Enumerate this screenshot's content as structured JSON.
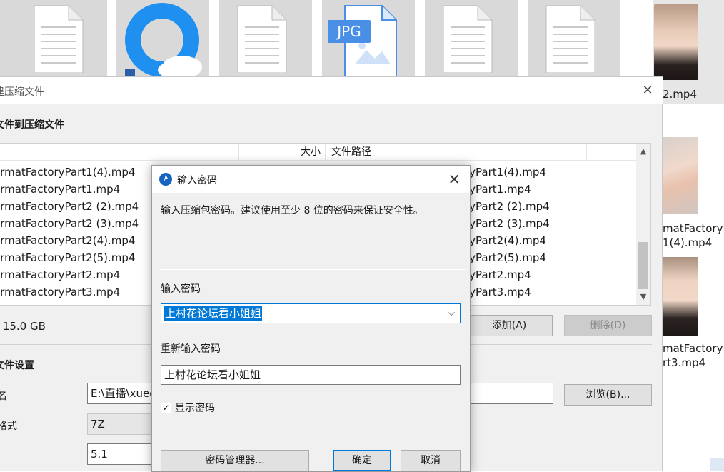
{
  "explorer": {
    "jpg_badge": "JPG",
    "side_videos": [
      {
        "label_line1": "2.mp4",
        "label_line2": ""
      },
      {
        "label_line1": "matFactoryP",
        "label_line2": "1(4).mp4"
      },
      {
        "label_line1": "matFactoryP",
        "label_line2": "rt3.mp4"
      }
    ]
  },
  "archive": {
    "title": "建压缩文件",
    "files_heading": "文件到压缩文件",
    "columns": {
      "size": "大小",
      "path": "文件路径"
    },
    "files": [
      {
        "name": "ormatFactoryPart1(4).mp4",
        "path": "ryPart1(4).mp4"
      },
      {
        "name": "ormatFactoryPart1.mp4",
        "path": "ryPart1.mp4"
      },
      {
        "name": "ormatFactoryPart2 (2).mp4",
        "path": "ryPart2 (2).mp4"
      },
      {
        "name": "ormatFactoryPart2 (3).mp4",
        "path": "ryPart2 (3).mp4"
      },
      {
        "name": "ormatFactoryPart2(4).mp4",
        "path": "ryPart2(4).mp4"
      },
      {
        "name": "ormatFactoryPart2(5).mp4",
        "path": "ryPart2(5).mp4"
      },
      {
        "name": "ormatFactoryPart2.mp4",
        "path": "ryPart2.mp4"
      },
      {
        "name": "ormatFactoryPart3.mp4",
        "path": "ryPart3.mp4"
      }
    ],
    "total_size": ": 15.0 GB",
    "add_label": "添加(A)",
    "delete_label": "删除(D)",
    "settings_heading": "文件设置",
    "path_row_label": "名",
    "path_value": "E:\\直播\\xuee",
    "browse_label": "浏览(B)...",
    "format_row_label": "格式",
    "format_value": "7Z",
    "version_value": "5.1"
  },
  "password_dialog": {
    "title": "输入密码",
    "hint": "输入压缩包密码。建议使用至少 8 位的密码来保证安全性。",
    "password_label": "输入密码",
    "password_value": "上村花论坛看小姐姐",
    "confirm_label": "重新输入密码",
    "confirm_value": "上村花论坛看小姐姐",
    "show_password_label": "显示密码",
    "show_password_checked": true,
    "manager_button": "密码管理器...",
    "ok_button": "确定",
    "cancel_button": "取消"
  },
  "colors": {
    "accent": "#0078d7",
    "dialog_bg": "#f0f0f0",
    "tile_bg": "#d9d9d9"
  }
}
